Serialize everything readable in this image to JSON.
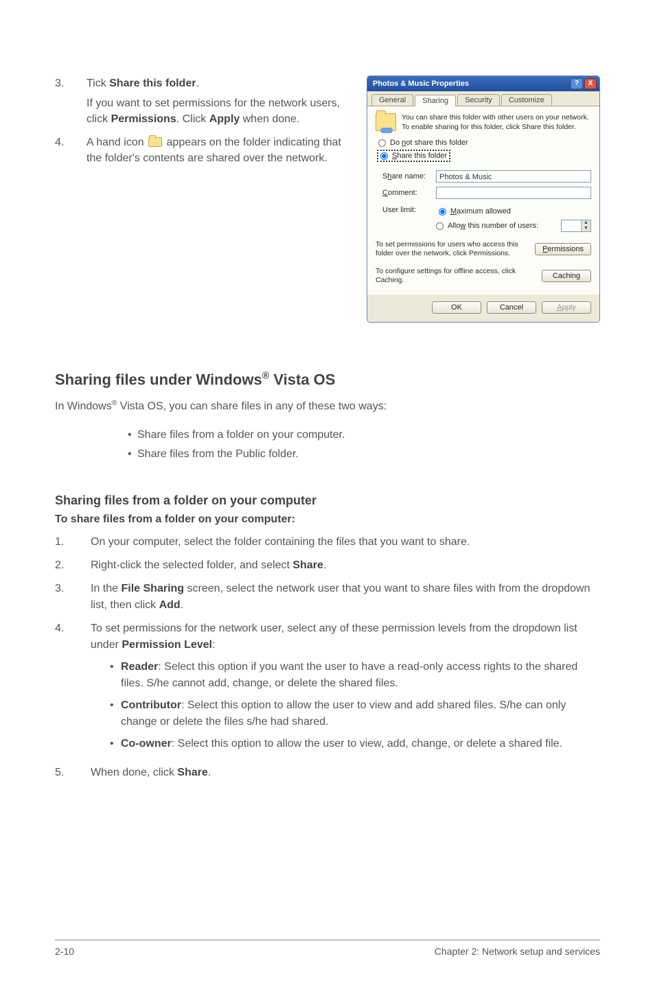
{
  "top_items": [
    {
      "num": "3.",
      "line1_a": "Tick ",
      "line1_b": "Share this folder",
      "line1_c": ".",
      "sub_a": "If you want to set permissions for the network users, click ",
      "sub_b": "Permissions",
      "sub_c": ". Click ",
      "sub_d": "Apply",
      "sub_e": " when done."
    },
    {
      "num": "4.",
      "line_a": "A hand icon ",
      "line_b": " appears on the folder indicating that the folder's contents are shared over the network."
    }
  ],
  "dialog": {
    "title": "Photos & Music Properties",
    "help_btn": "?",
    "close_btn": "X",
    "tabs": [
      "General",
      "Sharing",
      "Security",
      "Customize"
    ],
    "active_tab_index": 1,
    "info_text": "You can share this folder with other users on your network. To enable sharing for this folder, click Share this folder.",
    "opt_not_share_pre": "Do ",
    "opt_not_share_ul": "n",
    "opt_not_share_post": "ot share this folder",
    "opt_share_ul": "S",
    "opt_share_post": "hare this folder",
    "label_share_name_pre": "S",
    "label_share_name_ul": "h",
    "label_share_name_post": "are name:",
    "share_name_value": "Photos & Music",
    "label_comment_ul": "C",
    "label_comment_post": "omment:",
    "label_userlimit": "User limit:",
    "opt_max_ul": "M",
    "opt_max_post": "aximum allowed",
    "opt_allow_pre": "Allo",
    "opt_allow_ul": "w",
    "opt_allow_post": " this number of users:",
    "perm_text": "To set permissions for users who access this folder over the network, click Permissions.",
    "perm_btn_ul": "P",
    "perm_btn_post": "ermissions",
    "cache_text": "To configure settings for offline access, click Caching.",
    "cache_btn": "Caching",
    "ok_btn": "OK",
    "cancel_btn": "Cancel",
    "apply_btn_ul": "A",
    "apply_btn_post": "pply"
  },
  "section_heading_a": "Sharing files under Windows",
  "section_heading_sup": "®",
  "section_heading_b": " Vista OS",
  "intro_a": "In Windows",
  "intro_sup": "®",
  "intro_b": " Vista OS, you can share files in any of these two ways:",
  "two_ways": [
    "Share files from a folder on your computer.",
    "Share files from the Public folder."
  ],
  "sub_heading": "Sharing files from a folder on your computer",
  "sub_sub_heading": "To share files from a folder on your computer:",
  "steps": [
    {
      "num": "1.",
      "parts": [
        {
          "t": "On your computer, select the folder containing the files that you want to share."
        }
      ]
    },
    {
      "num": "2.",
      "parts": [
        {
          "t": "Right-click the selected folder, and select "
        },
        {
          "b": "Share"
        },
        {
          "t": "."
        }
      ]
    },
    {
      "num": "3.",
      "parts": [
        {
          "t": "In the "
        },
        {
          "b": "File Sharing"
        },
        {
          "t": " screen, select the network user that you want to share files with from the dropdown list, then click "
        },
        {
          "b": "Add"
        },
        {
          "t": "."
        }
      ]
    },
    {
      "num": "4.",
      "parts": [
        {
          "t": "To set permissions for the network user, select any of these permission levels from the dropdown list under "
        },
        {
          "b": "Permission Level"
        },
        {
          "t": ":"
        }
      ],
      "bullets": [
        [
          {
            "b": "Reader"
          },
          {
            "t": ": Select this option if you want the user to have a read-only access rights to the shared files. S/he cannot add, change, or delete the shared files."
          }
        ],
        [
          {
            "b": "Contributor"
          },
          {
            "t": ": Select this option to allow the user to view and add shared files. S/he can only change or delete the files s/he had shared."
          }
        ],
        [
          {
            "b": "Co-owner"
          },
          {
            "t": ": Select this option to allow the user to view, add, change, or delete a shared file."
          }
        ]
      ]
    },
    {
      "num": "5.",
      "parts": [
        {
          "t": "When done, click "
        },
        {
          "b": "Share"
        },
        {
          "t": "."
        }
      ]
    }
  ],
  "footer_left": "2-10",
  "footer_right": "Chapter 2:  Network setup and services"
}
